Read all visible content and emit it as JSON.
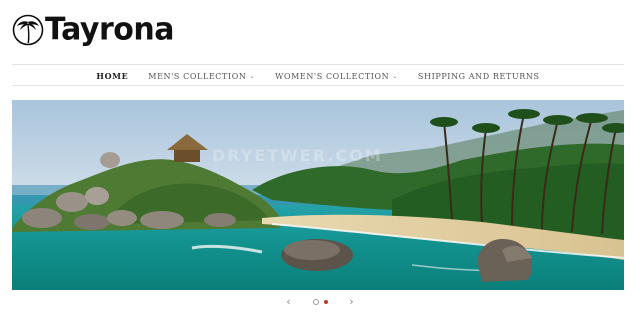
{
  "brand": {
    "name": "Tayrona",
    "logo_icon": "palm-tree-circle-logo"
  },
  "nav": {
    "items": [
      {
        "label": "HOME",
        "has_dropdown": false,
        "active": true
      },
      {
        "label": "MEN'S COLLECTION",
        "has_dropdown": true,
        "active": false
      },
      {
        "label": "WOMEN'S COLLECTION",
        "has_dropdown": true,
        "active": false
      },
      {
        "label": "SHIPPING AND RETURNS",
        "has_dropdown": false,
        "active": false
      }
    ],
    "dropdown_icon": "chevron-down-icon"
  },
  "hero": {
    "image_description_name": "hero-beach-image",
    "watermark": "DRYETWER.COM"
  },
  "slider": {
    "prev_icon": "chevron-left-icon",
    "next_icon": "chevron-right-icon",
    "slide_count": 2,
    "active_index": 1,
    "accent_color": "#c0392b"
  }
}
